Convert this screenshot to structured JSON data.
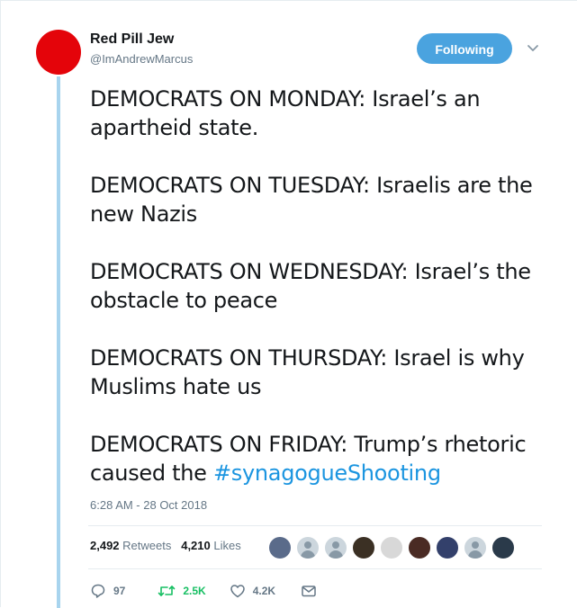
{
  "tweet": {
    "display_name": "Red Pill Jew",
    "handle": "@ImAndrewMarcus",
    "follow_label": "Following",
    "paragraphs": [
      "DEMOCRATS ON MONDAY: Israel’s an apartheid state.",
      "DEMOCRATS ON TUESDAY: Israelis are the new Nazis",
      "DEMOCRATS ON WEDNESDAY: Israel’s the obstacle to peace",
      "DEMOCRATS ON THURSDAY: Israel is why Muslims hate us"
    ],
    "last_paragraph_text": "DEMOCRATS ON FRIDAY: Trump’s rhetoric caused the ",
    "hashtag": "#synagogueShooting",
    "timestamp": "6:28 AM - 28 Oct 2018"
  },
  "stats": {
    "retweets_count": "2,492",
    "retweets_label": "Retweets",
    "likes_count": "4,210",
    "likes_label": "Likes"
  },
  "likers": [
    {
      "name": "liker-avatar-1",
      "color": "#5a6b8a"
    },
    {
      "name": "liker-avatar-2",
      "color": "default"
    },
    {
      "name": "liker-avatar-3",
      "color": "default"
    },
    {
      "name": "liker-avatar-4",
      "color": "#3b3024"
    },
    {
      "name": "liker-avatar-5",
      "color": "#d8d8d8"
    },
    {
      "name": "liker-avatar-6",
      "color": "#4a2b24"
    },
    {
      "name": "liker-avatar-7",
      "color": "#33406b"
    },
    {
      "name": "liker-avatar-8",
      "color": "default"
    },
    {
      "name": "liker-avatar-9",
      "color": "#2a3a4a"
    }
  ],
  "actions": {
    "replies": "97",
    "retweets": "2.5K",
    "likes": "4.2K"
  },
  "colors": {
    "avatar": "#e4040a",
    "follow_button": "#4aa3df",
    "hashtag": "#1b95e0",
    "retweet_green": "#17bf63",
    "thread_line": "#a8d4ee",
    "muted": "#657786"
  },
  "icons": {
    "caret": "chevron-down-icon",
    "reply": "reply-icon",
    "retweet": "retweet-icon",
    "like": "heart-icon",
    "dm": "envelope-icon"
  }
}
